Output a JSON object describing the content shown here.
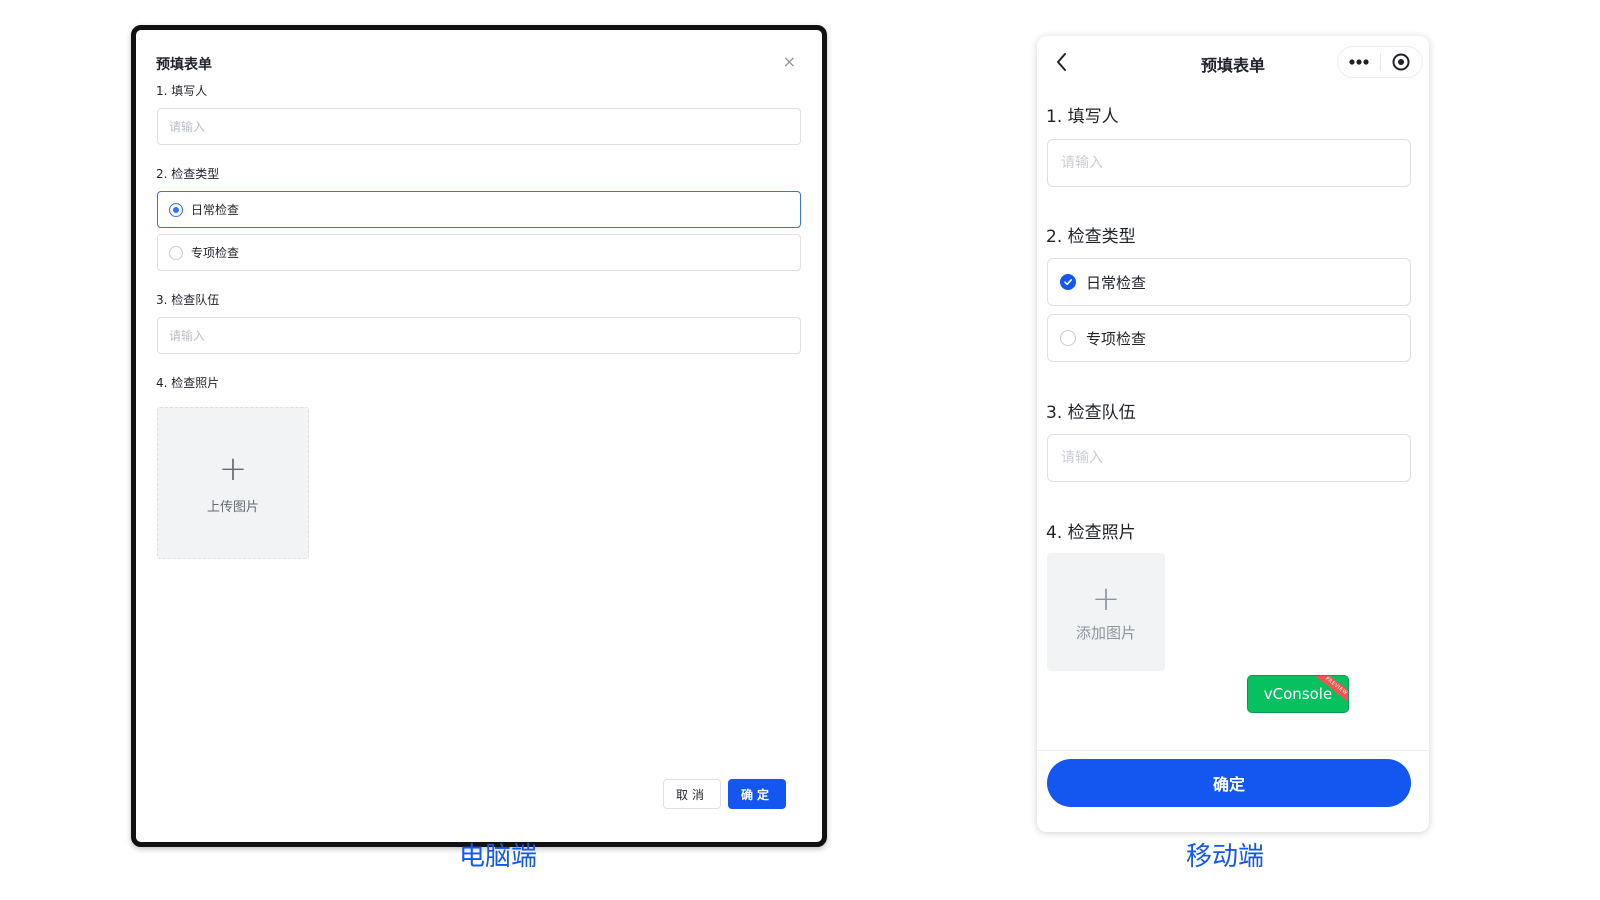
{
  "desktop": {
    "title": "预填表单",
    "close_icon": "×",
    "fields": {
      "filler": {
        "label": "1. 填写人",
        "placeholder": "请输入"
      },
      "type": {
        "label": "2. 检查类型",
        "options": [
          "日常检查",
          "专项检查"
        ],
        "selected": "日常检查"
      },
      "team": {
        "label": "3. 检查队伍",
        "placeholder": "请输入"
      },
      "photo": {
        "label": "4. 检查照片",
        "upload_label": "上传图片"
      }
    },
    "buttons": {
      "cancel": "取消",
      "ok": "确定"
    },
    "caption": "电脑端"
  },
  "mobile": {
    "title": "预填表单",
    "fields": {
      "filler": {
        "label": "1. 填写人",
        "placeholder": "请输入"
      },
      "type": {
        "label": "2. 检查类型",
        "options": [
          "日常检查",
          "专项检查"
        ],
        "selected": "日常检查"
      },
      "team": {
        "label": "3. 检查队伍",
        "placeholder": "请输入"
      },
      "photo": {
        "label": "4. 检查照片",
        "upload_label": "添加图片"
      }
    },
    "vconsole": {
      "label": "vConsole",
      "ribbon": "PREVIEW"
    },
    "submit": "确定",
    "caption": "移动端"
  },
  "colors": {
    "accent": "#1456f0",
    "radio_selected": "#3370ff",
    "vconsole_green": "#07c160",
    "ribbon_red": "#fa5151"
  },
  "icons": {
    "close": "close-icon",
    "back": "chevron-left-icon",
    "more": "more-dots-icon",
    "target": "target-icon",
    "upload": "plus-icon",
    "check": "check-icon"
  }
}
